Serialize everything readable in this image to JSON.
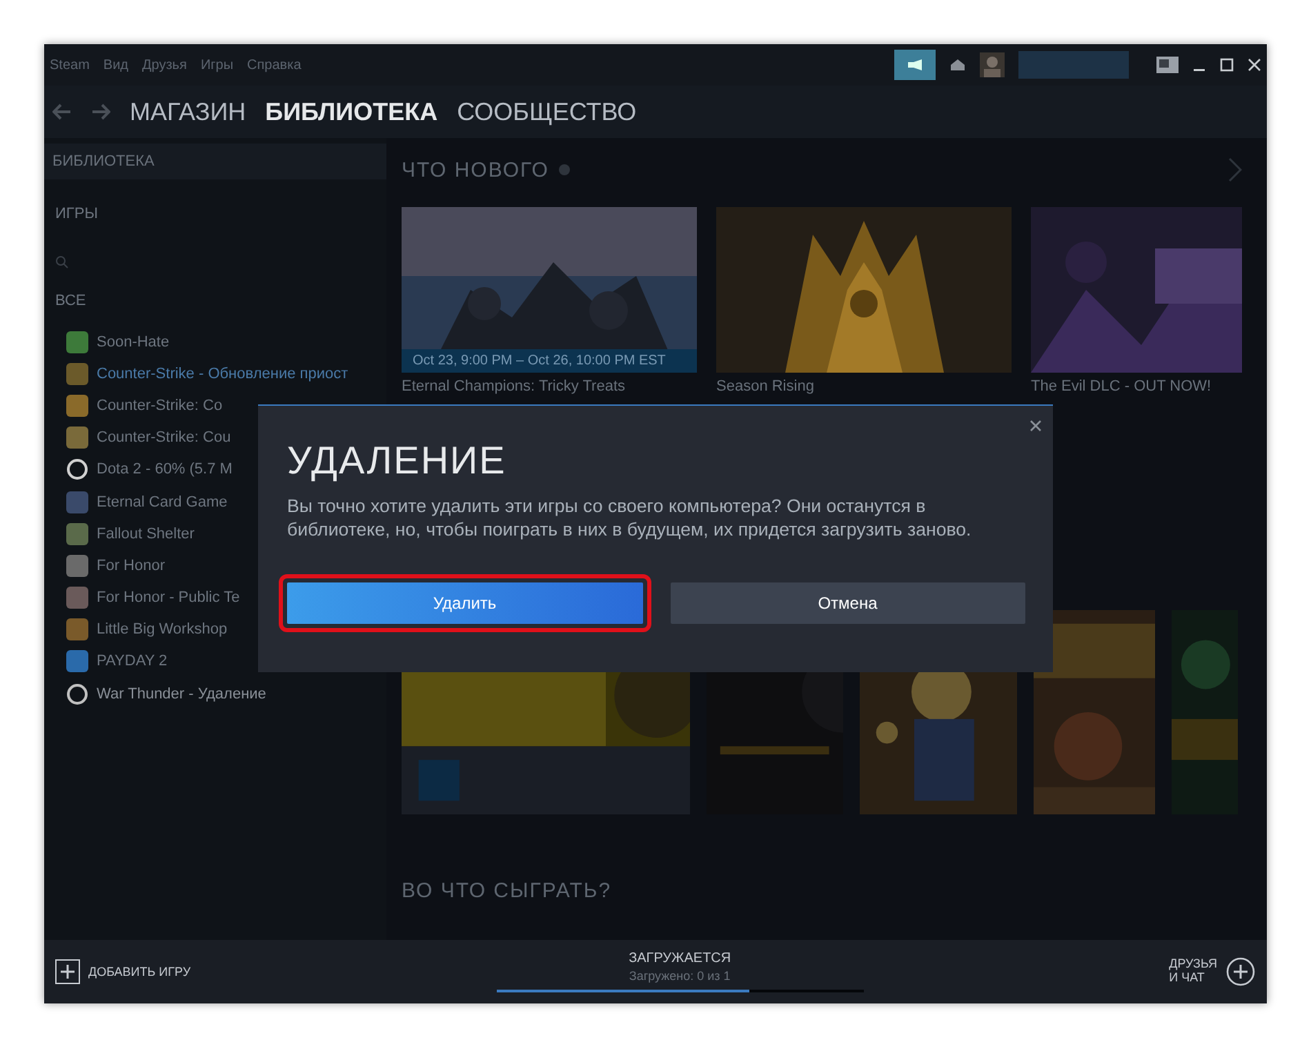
{
  "menu": [
    "Steam",
    "Вид",
    "Друзья",
    "Игры",
    "Справка"
  ],
  "nav_tabs": [
    {
      "label": "МАГАЗИН",
      "selected": false
    },
    {
      "label": "БИБЛИОТЕКА",
      "selected": true
    },
    {
      "label": "СООБЩЕСТВО",
      "selected": false
    }
  ],
  "sidebar": {
    "title": "БИБЛИОТЕКА",
    "filter": "ИГРЫ",
    "group": "ВСЕ",
    "games": [
      {
        "name": "Soon-Hate",
        "kind": "game",
        "color": "#3d7a3a"
      },
      {
        "name": "Counter-Strike",
        "status": "- Обновление приост",
        "kind": "game",
        "color": "#6b5a2a",
        "updating": true
      },
      {
        "name": "Counter-Strike: Co",
        "kind": "game",
        "color": "#8a6a2a"
      },
      {
        "name": "Counter-Strike: Cou",
        "kind": "game",
        "color": "#7a6a3a"
      },
      {
        "name": "Dota 2",
        "status": "- 60% (5.7 M",
        "kind": "ring",
        "color": "#d0d0d0"
      },
      {
        "name": "Eternal Card Game",
        "kind": "game",
        "color": "#3a4a6a"
      },
      {
        "name": "Fallout Shelter",
        "kind": "game",
        "color": "#5a6a4a"
      },
      {
        "name": "For Honor",
        "kind": "game",
        "color": "#6a6a6a"
      },
      {
        "name": "For Honor - Public Te",
        "kind": "game",
        "color": "#6a5a5a"
      },
      {
        "name": "Little Big Workshop",
        "kind": "game",
        "color": "#7a5a2a"
      },
      {
        "name": "PAYDAY 2",
        "kind": "game",
        "color": "#2a6aaa"
      },
      {
        "name": "War Thunder",
        "status": "- Удаление",
        "kind": "ring",
        "color": "#c0c0c0"
      }
    ]
  },
  "whats_new": {
    "title": "ЧТО НОВОГО",
    "tiles": [
      {
        "date": "Oct 23, 9:00 PM – Oct 26, 10:00 PM EST",
        "caption": "Eternal Champions: Tricky Treats"
      },
      {
        "caption": "Season Rising"
      },
      {
        "caption": "The Evil DLC - OUT NOW!"
      }
    ]
  },
  "play_next": {
    "title": "ВО ЧТО СЫГРАТЬ?"
  },
  "bottom_bar": {
    "add_game": "ДОБАВИТЬ ИГРУ",
    "download_title": "ЗАГРУЖАЕТСЯ",
    "download_status": "Загружено: 0 из 1",
    "level": 0.69,
    "friends": "ДРУЗЬЯ\nИ ЧАТ"
  },
  "dialog": {
    "title": "УДАЛЕНИЕ",
    "message": "Вы точно хотите удалить эти игры со своего компьютера? Они останутся в библиотеке, но, чтобы поиграть в них в будущем, их придется загрузить заново.",
    "buttons": [
      {
        "label": "Удалить",
        "kind": "primary",
        "highlighted": true
      },
      {
        "label": "Отмена",
        "kind": "secondary",
        "highlighted": false
      }
    ]
  }
}
